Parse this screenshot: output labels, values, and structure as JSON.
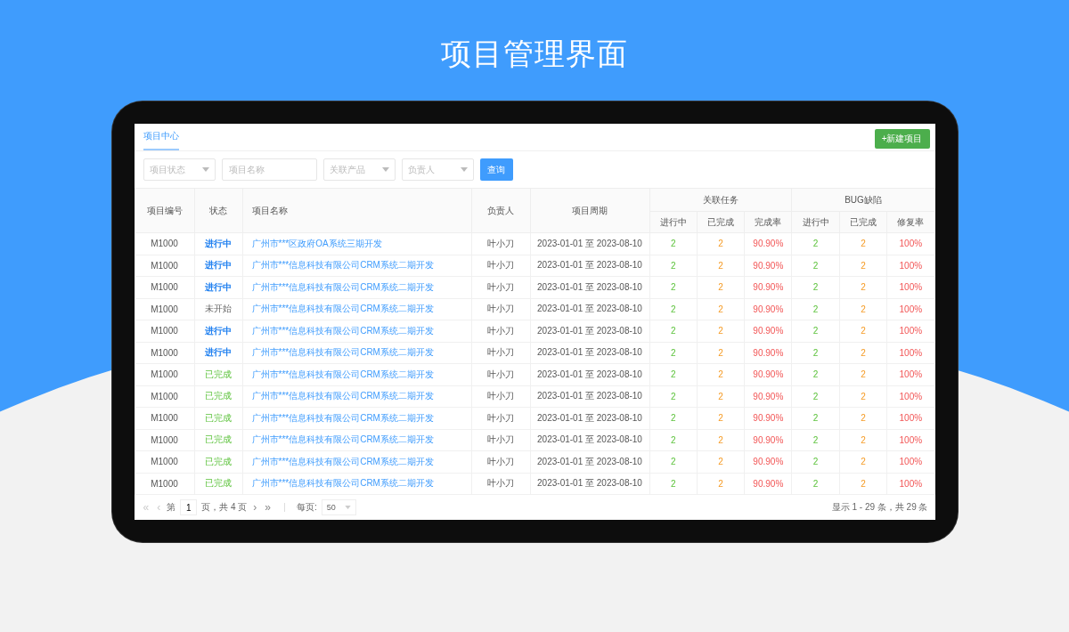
{
  "headline": "项目管理界面",
  "tabs": [
    {
      "label": "项目中心",
      "selected": true
    }
  ],
  "new_button": "+新建项目",
  "filters": [
    {
      "kind": "select",
      "placeholder": "项目状态"
    },
    {
      "kind": "input",
      "placeholder": "项目名称"
    },
    {
      "kind": "select",
      "placeholder": "关联产品"
    },
    {
      "kind": "select",
      "placeholder": "负责人"
    }
  ],
  "search_button": "查询",
  "table": {
    "columns": [
      "项目编号",
      "状态",
      "项目名称",
      "负责人",
      "项目周期"
    ],
    "groups": [
      {
        "label": "关联任务",
        "columns": [
          "进行中",
          "已完成",
          "完成率"
        ]
      },
      {
        "label": "BUG缺陷",
        "columns": [
          "进行中",
          "已完成",
          "修复率"
        ]
      }
    ],
    "rows": [
      {
        "id": "M1000",
        "status": {
          "label": "进行中",
          "kind": "active"
        },
        "name": "广州市***区政府OA系统三期开发",
        "owner": "叶小刀",
        "period": "2023-01-01 至 2023-08-10",
        "tasks": [
          "2",
          "2",
          "90.90%"
        ],
        "bugs": [
          "2",
          "2",
          "100%"
        ]
      },
      {
        "id": "M1000",
        "status": {
          "label": "进行中",
          "kind": "active"
        },
        "name": "广州市***信息科技有限公司CRM系统二期开发",
        "owner": "叶小刀",
        "period": "2023-01-01 至 2023-08-10",
        "tasks": [
          "2",
          "2",
          "90.90%"
        ],
        "bugs": [
          "2",
          "2",
          "100%"
        ]
      },
      {
        "id": "M1000",
        "status": {
          "label": "进行中",
          "kind": "active"
        },
        "name": "广州市***信息科技有限公司CRM系统二期开发",
        "owner": "叶小刀",
        "period": "2023-01-01 至 2023-08-10",
        "tasks": [
          "2",
          "2",
          "90.90%"
        ],
        "bugs": [
          "2",
          "2",
          "100%"
        ]
      },
      {
        "id": "M1000",
        "status": {
          "label": "未开始",
          "kind": "pending"
        },
        "name": "广州市***信息科技有限公司CRM系统二期开发",
        "owner": "叶小刀",
        "period": "2023-01-01 至 2023-08-10",
        "tasks": [
          "2",
          "2",
          "90.90%"
        ],
        "bugs": [
          "2",
          "2",
          "100%"
        ]
      },
      {
        "id": "M1000",
        "status": {
          "label": "进行中",
          "kind": "active"
        },
        "name": "广州市***信息科技有限公司CRM系统二期开发",
        "owner": "叶小刀",
        "period": "2023-01-01 至 2023-08-10",
        "tasks": [
          "2",
          "2",
          "90.90%"
        ],
        "bugs": [
          "2",
          "2",
          "100%"
        ]
      },
      {
        "id": "M1000",
        "status": {
          "label": "进行中",
          "kind": "active"
        },
        "name": "广州市***信息科技有限公司CRM系统二期开发",
        "owner": "叶小刀",
        "period": "2023-01-01 至 2023-08-10",
        "tasks": [
          "2",
          "2",
          "90.90%"
        ],
        "bugs": [
          "2",
          "2",
          "100%"
        ]
      },
      {
        "id": "M1000",
        "status": {
          "label": "已完成",
          "kind": "done"
        },
        "name": "广州市***信息科技有限公司CRM系统二期开发",
        "owner": "叶小刀",
        "period": "2023-01-01 至 2023-08-10",
        "tasks": [
          "2",
          "2",
          "90.90%"
        ],
        "bugs": [
          "2",
          "2",
          "100%"
        ]
      },
      {
        "id": "M1000",
        "status": {
          "label": "已完成",
          "kind": "done"
        },
        "name": "广州市***信息科技有限公司CRM系统二期开发",
        "owner": "叶小刀",
        "period": "2023-01-01 至 2023-08-10",
        "tasks": [
          "2",
          "2",
          "90.90%"
        ],
        "bugs": [
          "2",
          "2",
          "100%"
        ]
      },
      {
        "id": "M1000",
        "status": {
          "label": "已完成",
          "kind": "done"
        },
        "name": "广州市***信息科技有限公司CRM系统二期开发",
        "owner": "叶小刀",
        "period": "2023-01-01 至 2023-08-10",
        "tasks": [
          "2",
          "2",
          "90.90%"
        ],
        "bugs": [
          "2",
          "2",
          "100%"
        ]
      },
      {
        "id": "M1000",
        "status": {
          "label": "已完成",
          "kind": "done"
        },
        "name": "广州市***信息科技有限公司CRM系统二期开发",
        "owner": "叶小刀",
        "period": "2023-01-01 至 2023-08-10",
        "tasks": [
          "2",
          "2",
          "90.90%"
        ],
        "bugs": [
          "2",
          "2",
          "100%"
        ]
      },
      {
        "id": "M1000",
        "status": {
          "label": "已完成",
          "kind": "done"
        },
        "name": "广州市***信息科技有限公司CRM系统二期开发",
        "owner": "叶小刀",
        "period": "2023-01-01 至 2023-08-10",
        "tasks": [
          "2",
          "2",
          "90.90%"
        ],
        "bugs": [
          "2",
          "2",
          "100%"
        ]
      },
      {
        "id": "M1000",
        "status": {
          "label": "已完成",
          "kind": "done"
        },
        "name": "广州市***信息科技有限公司CRM系统二期开发",
        "owner": "叶小刀",
        "period": "2023-01-01 至 2023-08-10",
        "tasks": [
          "2",
          "2",
          "90.90%"
        ],
        "bugs": [
          "2",
          "2",
          "100%"
        ]
      }
    ]
  },
  "pagination": {
    "first": "«",
    "prev": "‹",
    "page_prefix": "第",
    "page": "1",
    "page_suffix": "页，共 4 页",
    "next": "›",
    "last": "»",
    "per_page_label": "每页:",
    "per_page": "50",
    "summary": "显示 1 - 29 条，共 29 条"
  }
}
